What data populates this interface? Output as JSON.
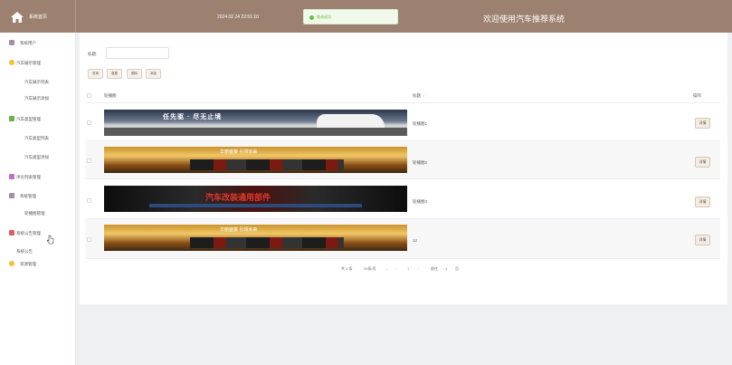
{
  "header": {
    "brand": "系统首页",
    "datetime": "2024 02 24 22:51:10",
    "toast": "查询成功",
    "welcome": "欢迎使用汽车推荐系统"
  },
  "sidebar": {
    "items": [
      {
        "label": "系统用户",
        "icon": "user-icon",
        "color": "#a58fa8"
      },
      {
        "label": "汽车展示管理",
        "icon": "circle-icon",
        "color": "#f1c232"
      },
      {
        "label": "汽车展示列表"
      },
      {
        "label": "汽车展示添加"
      },
      {
        "label": "汽车类型管理",
        "icon": "square-icon",
        "color": "#6ab04c"
      },
      {
        "label": "汽车类型列表"
      },
      {
        "label": "汽车类型添加"
      },
      {
        "label": "评论列表管理",
        "icon": "square-icon",
        "color": "#c06fc8"
      },
      {
        "label": "系统管理",
        "icon": "gear-icon",
        "color": "#a58fa8"
      },
      {
        "label": "轮播图管理"
      },
      {
        "label": "系统公告管理",
        "icon": "grid-icon",
        "color": "#e35d5d"
      },
      {
        "label": "系统公告"
      },
      {
        "label": "资源管理",
        "icon": "circle-icon",
        "color": "#f1c232"
      }
    ]
  },
  "filter": {
    "label": "标题:",
    "value": "",
    "buttons": [
      "查询",
      "重置",
      "删除",
      "添加"
    ]
  },
  "table": {
    "headers": {
      "image": "轮播图",
      "title": "标题",
      "action": "操作"
    },
    "rows": [
      {
        "banner_text": "任先驱 · 尽无止境",
        "title": "轮播图1",
        "action": "详情"
      },
      {
        "banner_text": "华丽盛宴  引领未来",
        "title": "轮播图2",
        "action": "详情"
      },
      {
        "banner_text": "汽车改装通用部件",
        "title": "轮播图3",
        "action": "详情"
      },
      {
        "banner_text": "华丽盛宴  引领未来",
        "title": "12",
        "action": "详情"
      }
    ]
  },
  "pagination": {
    "total": "共 4 条",
    "page_size": "10条/页",
    "current": "1",
    "goto_label": "前往",
    "goto_value": "1",
    "page_unit": "页"
  }
}
